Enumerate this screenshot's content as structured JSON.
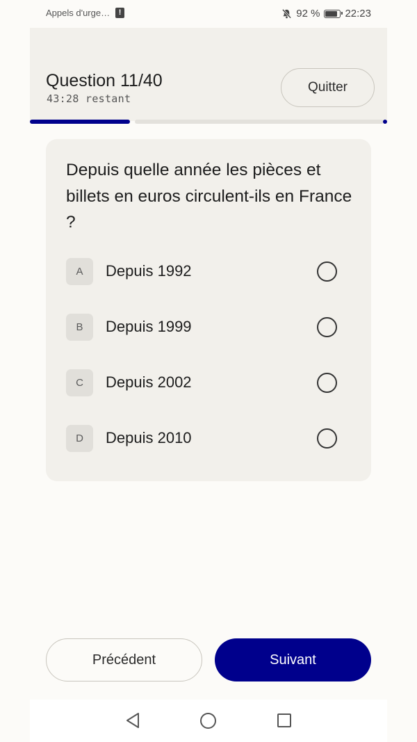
{
  "status_bar": {
    "carrier": "Appels d'urge…",
    "battery_percent": "92 %",
    "time": "22:23",
    "icons": [
      "alert-icon",
      "bell-muted-icon",
      "battery-icon"
    ]
  },
  "header": {
    "title": "Question 11/40",
    "timer": "43:28 restant",
    "quit_label": "Quitter",
    "progress": 0.275
  },
  "question": {
    "text": "Depuis quelle année les pièces et billets en euros circulent-ils en France ?",
    "options": [
      {
        "letter": "A",
        "label": "Depuis 1992",
        "selected": false
      },
      {
        "letter": "B",
        "label": "Depuis 1999",
        "selected": false
      },
      {
        "letter": "C",
        "label": "Depuis 2002",
        "selected": false
      },
      {
        "letter": "D",
        "label": "Depuis 2010",
        "selected": false
      }
    ]
  },
  "footer": {
    "prev_label": "Précédent",
    "next_label": "Suivant"
  },
  "colors": {
    "accent": "#00008c",
    "background": "#fcfbf8",
    "card": "#f2f0eb"
  },
  "nav_bar": {
    "icons": [
      "back-icon",
      "home-icon",
      "recent-apps-icon"
    ]
  }
}
